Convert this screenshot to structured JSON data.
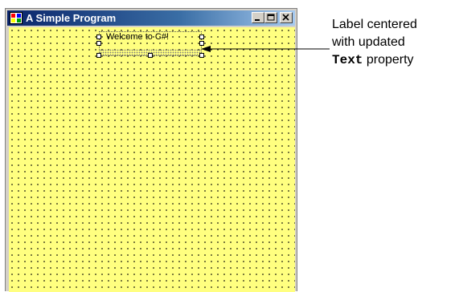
{
  "window": {
    "title": "A Simple Program",
    "title_bar_color": "#0a246a",
    "client_color": "#ffff80"
  },
  "caption_buttons": [
    {
      "name": "minimize",
      "icon": "minimize-icon"
    },
    {
      "name": "maximize",
      "icon": "maximize-icon"
    },
    {
      "name": "close",
      "icon": "close-icon"
    }
  ],
  "label_control": {
    "text": "Welcome to C#!"
  },
  "callout": {
    "line1": "Label centered",
    "line2": "with updated",
    "code_word": "Text",
    "line3_suffix": " property"
  }
}
